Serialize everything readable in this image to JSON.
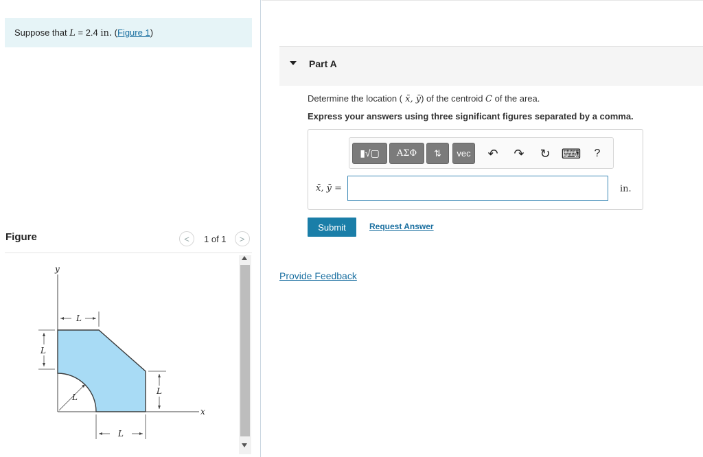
{
  "problem": {
    "prefix": "Suppose that ",
    "variable": "L",
    "equals": " = 2.4 ",
    "unit": "in.",
    "paren_open": " (",
    "figure_link": "Figure 1",
    "paren_close": ")"
  },
  "figure_panel": {
    "title": "Figure",
    "pager_prev": "<",
    "pager_text": "1 of 1",
    "pager_next": ">",
    "diagram_labels": {
      "y_axis": "y",
      "x_axis": "x",
      "top_dim": "L",
      "left_dim": "L",
      "arc_radius": "L",
      "right_dim": "L",
      "bottom_dim": "L"
    },
    "colors": {
      "shape_fill": "#a8dbf5",
      "shape_stroke": "#3c3c3c"
    }
  },
  "part": {
    "title": "Part A",
    "question_prefix": "Determine the location (",
    "question_vars": " x̄, ȳ",
    "question_middle": ") of the centroid ",
    "question_c": "C",
    "question_suffix": " of the area.",
    "instruction": "Express your answers using three significant figures separated by a comma."
  },
  "toolbar": {
    "templates_label": "▮√▢",
    "greek_label": "ΑΣΦ",
    "sort_label": "⇅",
    "vec_label": "vec",
    "undo_icon": "↶",
    "redo_icon": "↷",
    "reset_icon": "↻",
    "keyboard_icon": "⌨",
    "help_label": "?"
  },
  "answer": {
    "label": "x̄, ȳ =",
    "value": "",
    "unit": "in."
  },
  "actions": {
    "submit_label": "Submit",
    "request_label": "Request Answer",
    "feedback_label": "Provide Feedback"
  },
  "colors": {
    "accent": "#1a7ea8",
    "link": "#1a6fa0",
    "problem_bg": "#e6f4f7"
  }
}
